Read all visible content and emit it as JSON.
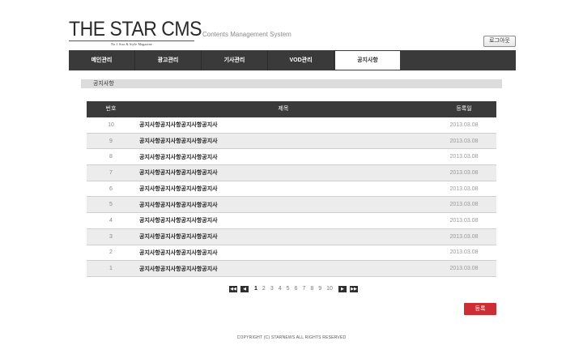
{
  "header": {
    "logo_text": "THE STAR CMS",
    "logo_tagline": "No.1 Star & Style Magazine",
    "subtitle": "Contents Management System",
    "logout_label": "로그아웃"
  },
  "nav": {
    "items": [
      {
        "label": "메인관리"
      },
      {
        "label": "광고관리"
      },
      {
        "label": "기사관리"
      },
      {
        "label": "VOD관리"
      },
      {
        "label": "공지사항"
      }
    ],
    "active_index": 4
  },
  "section": {
    "title": "공지사항"
  },
  "table": {
    "headers": {
      "no": "번호",
      "title": "제목",
      "date": "등록일"
    },
    "rows": [
      {
        "no": "10",
        "title": "공지사항공지사항공지사항공지사",
        "date": "2013.03.08"
      },
      {
        "no": "9",
        "title": "공지사항공지사항공지사항공지사",
        "date": "2013.03.08"
      },
      {
        "no": "8",
        "title": "공지사항공지사항공지사항공지사",
        "date": "2013.03.08"
      },
      {
        "no": "7",
        "title": "공지사항공지사항공지사항공지사",
        "date": "2013.03.08"
      },
      {
        "no": "6",
        "title": "공지사항공지사항공지사항공지사",
        "date": "2013.03.08"
      },
      {
        "no": "5",
        "title": "공지사항공지사항공지사항공지사",
        "date": "2013.03.08"
      },
      {
        "no": "4",
        "title": "공지사항공지사항공지사항공지사",
        "date": "2013.03.08"
      },
      {
        "no": "3",
        "title": "공지사항공지사항공지사항공지사",
        "date": "2013.03.08"
      },
      {
        "no": "2",
        "title": "공지사항공지사항공지사항공지사",
        "date": "2013.03.08"
      },
      {
        "no": "1",
        "title": "공지사항공지사항공지사항공지사",
        "date": "2013.03.08"
      }
    ]
  },
  "pagination": {
    "first_icon": "double-chevron-left-icon",
    "prev_icon": "chevron-left-icon",
    "next_icon": "chevron-right-icon",
    "last_icon": "double-chevron-right-icon",
    "pages": [
      "1",
      "2",
      "3",
      "4",
      "5",
      "6",
      "7",
      "8",
      "9",
      "10"
    ],
    "current": "1"
  },
  "actions": {
    "register_label": "등록"
  },
  "colors": {
    "nav_bg": "#3a3a3a",
    "register_btn": "#cc2f33",
    "section_bar": "#dcdcdc"
  },
  "footer": {
    "copyright": "COPYRIGHT (C) STARNEWS ALL RIGHTS RESERVED"
  }
}
